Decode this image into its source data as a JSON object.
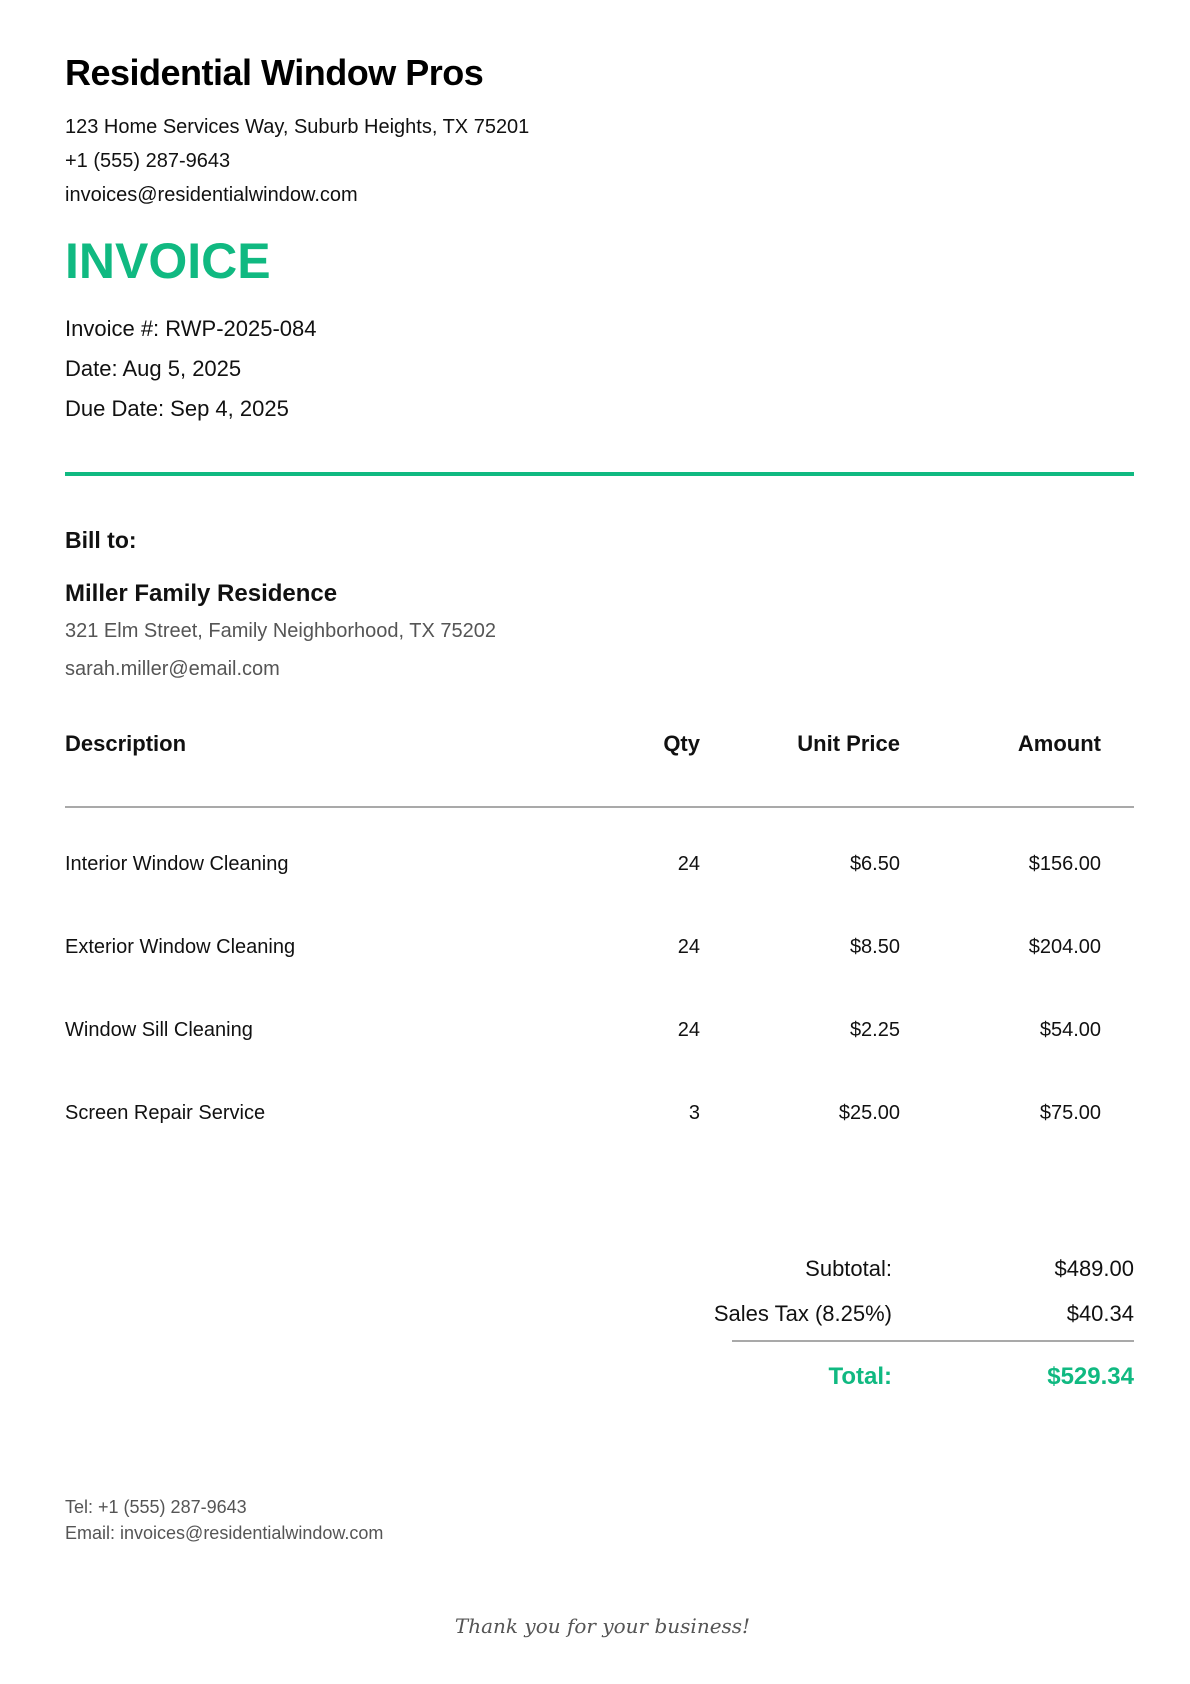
{
  "colors": {
    "accent": "#10b981"
  },
  "company": {
    "name": "Residential Window Pros",
    "address": "123 Home Services Way, Suburb Heights, TX 75201",
    "phone": "+1 (555) 287-9643",
    "email": "invoices@residentialwindow.com"
  },
  "invoice": {
    "title": "INVOICE",
    "number_line": "Invoice #: RWP-2025-084",
    "date_line": "Date: Aug 5, 2025",
    "due_line": "Due Date: Sep 4, 2025"
  },
  "bill_to": {
    "heading": "Bill to:",
    "name": "Miller Family Residence",
    "address": "321 Elm Street, Family Neighborhood, TX 75202",
    "email": "sarah.miller@email.com"
  },
  "table": {
    "headers": {
      "description": "Description",
      "qty": "Qty",
      "unit_price": "Unit Price",
      "amount": "Amount"
    },
    "rows": [
      {
        "description": "Interior Window Cleaning",
        "qty": "24",
        "unit_price": "$6.50",
        "amount": "$156.00"
      },
      {
        "description": "Exterior Window Cleaning",
        "qty": "24",
        "unit_price": "$8.50",
        "amount": "$204.00"
      },
      {
        "description": "Window Sill Cleaning",
        "qty": "24",
        "unit_price": "$2.25",
        "amount": "$54.00"
      },
      {
        "description": "Screen Repair Service",
        "qty": "3",
        "unit_price": "$25.00",
        "amount": "$75.00"
      }
    ]
  },
  "totals": {
    "subtotal_label": "Subtotal:",
    "subtotal_value": "$489.00",
    "tax_label": "Sales Tax (8.25%)",
    "tax_value": "$40.34",
    "total_label": "Total:",
    "total_value": "$529.34"
  },
  "footer": {
    "tel": "Tel: +1 (555) 287-9643",
    "email": "Email: invoices@residentialwindow.com",
    "thanks": "Thank you for your business!"
  }
}
